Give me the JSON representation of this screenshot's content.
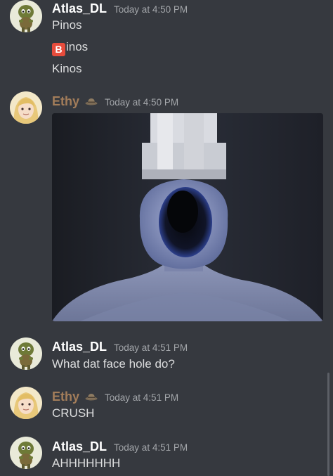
{
  "messages": [
    {
      "author": "Atlas_DL",
      "timestamp": "Today at 4:50 PM",
      "lines": [
        "Pinos",
        "inos",
        "Kinos"
      ],
      "b_emoji": "B"
    },
    {
      "author": "Ethy",
      "timestamp": "Today at 4:50 PM",
      "badge_icon": "fedora-hat-icon",
      "attachment_icon": "faceless-figure-image"
    },
    {
      "author": "Atlas_DL",
      "timestamp": "Today at 4:51 PM",
      "lines": [
        "What dat face hole do?"
      ]
    },
    {
      "author": "Ethy",
      "timestamp": "Today at 4:51 PM",
      "badge_icon": "fedora-hat-icon",
      "lines": [
        "CRUSH"
      ]
    },
    {
      "author": "Atlas_DL",
      "timestamp": "Today at 4:51 PM",
      "lines": [
        "AHHHHHHH"
      ]
    }
  ],
  "colors": {
    "background": "#36393f",
    "atlas_name": "#ffffff",
    "ethy_name": "#a37d5a",
    "timestamp": "#a3a6aa",
    "text": "#dcddde",
    "b_emoji_bg": "#e74c3c"
  }
}
